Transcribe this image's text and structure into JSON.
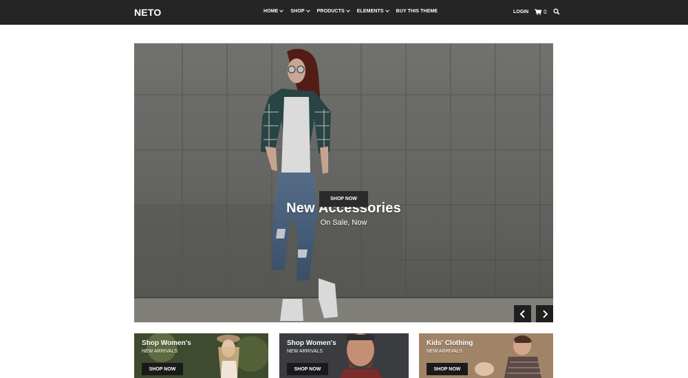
{
  "header": {
    "logo": "NETO",
    "nav": [
      {
        "label": "HOME",
        "dropdown": true
      },
      {
        "label": "SHOP",
        "dropdown": true
      },
      {
        "label": "PRODUCTS",
        "dropdown": true
      },
      {
        "label": "ELEMENTS",
        "dropdown": true
      },
      {
        "label": "BUY THIS THEME",
        "dropdown": false
      }
    ],
    "login_label": "LOGIN",
    "cart_count": "0",
    "cart_icon": "cart-icon",
    "search_icon": "search-icon"
  },
  "hero": {
    "title": "New Accessories",
    "subtitle": "On Sale, Now",
    "button_label": "SHOP NOW",
    "prev_icon": "chevron-left-icon",
    "next_icon": "chevron-right-icon"
  },
  "tiles": [
    {
      "title": "Shop Women's",
      "subtitle": "NEW ARRIVALS",
      "button_label": "SHOP NOW"
    },
    {
      "title": "Shop Women's",
      "subtitle": "NEW ARRIVALS",
      "button_label": "SHOP NOW"
    },
    {
      "title": "Kids' Clothing",
      "subtitle": "NEW ARRIVALS",
      "button_label": "SHOP NOW"
    }
  ],
  "colors": {
    "topbar": "#252525",
    "button": "#2b2b2b",
    "text_on_dark": "#ffffff"
  }
}
